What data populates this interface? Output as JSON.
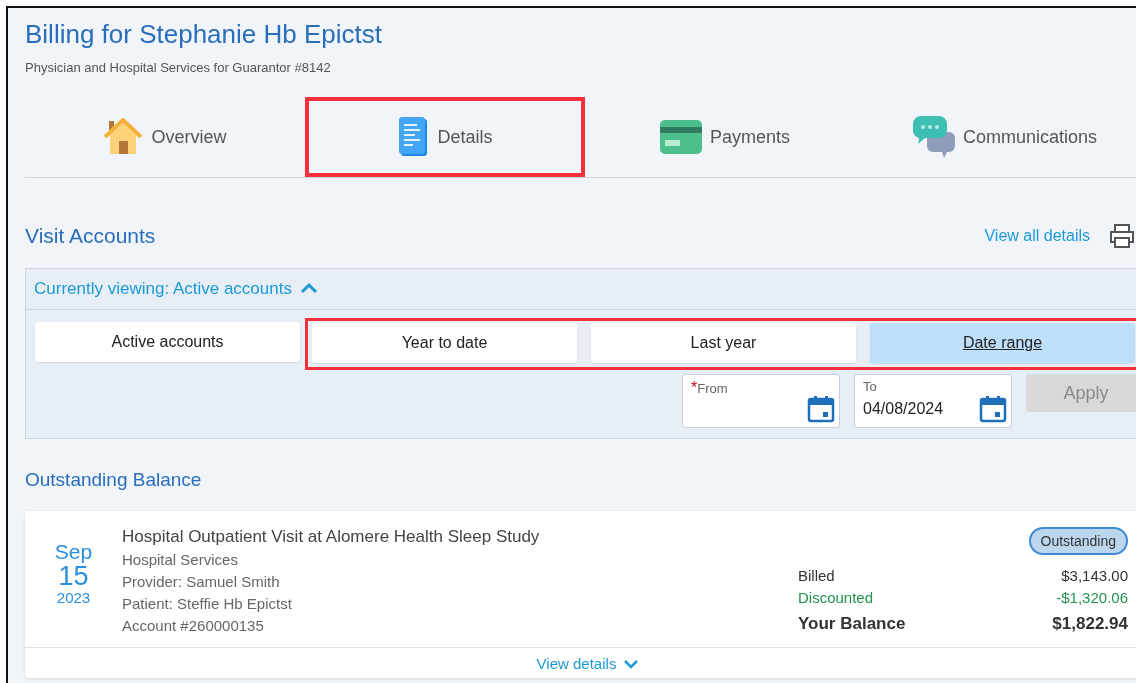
{
  "header": {
    "title": "Billing for Stephanie Hb Epictst",
    "subtitle": "Physician and Hospital Services for Guarantor #8142"
  },
  "tabs": [
    {
      "label": "Overview",
      "highlighted": false
    },
    {
      "label": "Details",
      "highlighted": true
    },
    {
      "label": "Payments",
      "highlighted": false
    },
    {
      "label": "Communications",
      "highlighted": false
    }
  ],
  "visit_accounts": {
    "title": "Visit Accounts",
    "link": "View all details",
    "filter_panel": {
      "toggle": "Currently viewing: Active accounts",
      "expanded": true,
      "options": [
        {
          "label": "Active accounts",
          "selected": false,
          "highlighted": false
        },
        {
          "label": "Year to date",
          "selected": false,
          "highlighted": true
        },
        {
          "label": "Last year",
          "selected": false,
          "highlighted": true
        },
        {
          "label": "Date range",
          "selected": true,
          "highlighted": true
        }
      ],
      "from": {
        "label": "From",
        "required_mark": "*"
      },
      "to": {
        "label": "To",
        "value": "04/08/2024"
      },
      "apply": {
        "label": "Apply",
        "disabled": true
      }
    }
  },
  "outstanding_balance": {
    "title": "Outstanding Balance",
    "visits": [
      {
        "month": "Sep",
        "day": "15",
        "year": "2023",
        "title": "Hospital Outpatient Visit at Alomere Health Sleep Study",
        "lines": [
          "Hospital Services",
          "Provider: Samuel Smith",
          "Patient: Steffie Hb Epictst",
          "Account #260000135"
        ],
        "status": "Outstanding",
        "amounts": [
          {
            "label": "Billed",
            "value": "$3,143.00",
            "kind": "normal"
          },
          {
            "label": "Discounted",
            "value": "-$1,320.06",
            "kind": "discount"
          },
          {
            "label": "Your Balance",
            "value": "$1,822.94",
            "kind": "total"
          }
        ],
        "details_link": "View details",
        "expanded": false
      }
    ]
  }
}
